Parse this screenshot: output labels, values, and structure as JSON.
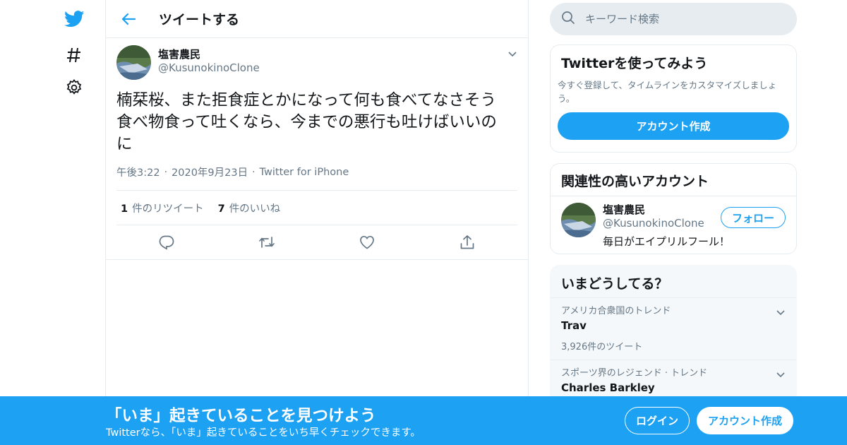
{
  "nav": {
    "icons": [
      "twitter-bird-icon",
      "hashtag-icon",
      "gear-icon"
    ]
  },
  "header": {
    "title": "ツイートする"
  },
  "tweet": {
    "author": {
      "display_name": "塩害農民",
      "handle": "@KusunokinoClone"
    },
    "text": "楠栞桜、また拒食症とかになって何も食べてなさそう\n食べ物食って吐くなら、今までの悪行も吐けばいいの\nに",
    "time": "午後3:22",
    "date": "2020年9月23日",
    "source": "Twitter for iPhone",
    "separator": "·",
    "retweets": {
      "count": "1",
      "label": "件のリツイート"
    },
    "likes": {
      "count": "7",
      "label": "件のいいね"
    },
    "actions": [
      "reply-icon",
      "retweet-icon",
      "like-icon",
      "share-icon"
    ]
  },
  "search": {
    "placeholder": "キーワード検索"
  },
  "signup_card": {
    "title": "Twitterを使ってみよう",
    "description": "今すぐ登録して、タイムラインをカスタマイズしましょう。",
    "button": "アカウント作成"
  },
  "related": {
    "title": "関連性の高いアカウント",
    "user": {
      "display_name": "塩害農民",
      "handle": "@KusunokinoClone",
      "bio": "毎日がエイプリルフール！",
      "follow_label": "フォロー"
    }
  },
  "trends": {
    "title": "いまどうしてる？",
    "items": [
      {
        "context": "アメリカ合衆国のトレンド",
        "name": "Trav",
        "count": "3,926件のツイート"
      },
      {
        "context": "スポーツ界のレジェンド · トレンド",
        "name": "Charles Barkley"
      }
    ]
  },
  "banner": {
    "title": "「いま」起きていることを見つけよう",
    "subtitle": "Twitterなら、「いま」起きていることをいち早くチェックできます。",
    "login": "ログイン",
    "signup": "アカウント作成"
  },
  "colors": {
    "accent": "#1da1f2",
    "text": "#14171a",
    "muted": "#657786",
    "border": "#e6ecf0"
  }
}
